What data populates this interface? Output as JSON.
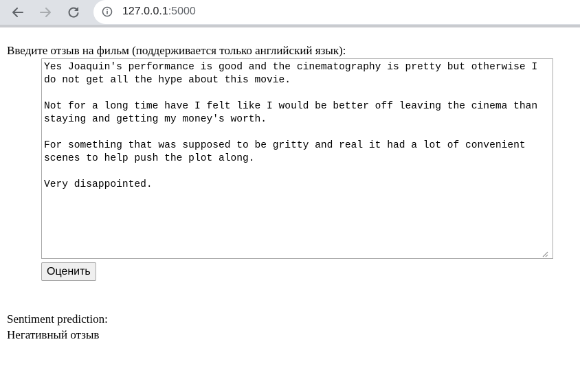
{
  "browser": {
    "url_host": "127.0.0.1",
    "url_port": ":5000",
    "back_icon": "arrow-left-icon",
    "forward_icon": "arrow-right-icon",
    "reload_icon": "reload-icon",
    "info_icon": "info-icon"
  },
  "form": {
    "prompt": "Введите отзыв на фильм (поддерживается только английский язык):",
    "review_text": "Yes Joaquin's performance is good and the cinematography is pretty but otherwise I do not get all the hype about this movie.\n\nNot for a long time have I felt like I would be better off leaving the cinema than staying and getting my money's worth.\n\nFor something that was supposed to be gritty and real it had a lot of convenient scenes to help push the plot along.\n\nVery disappointed.",
    "submit_label": "Оценить"
  },
  "result": {
    "label": "Sentiment prediction:",
    "value": "Негативный отзыв"
  }
}
